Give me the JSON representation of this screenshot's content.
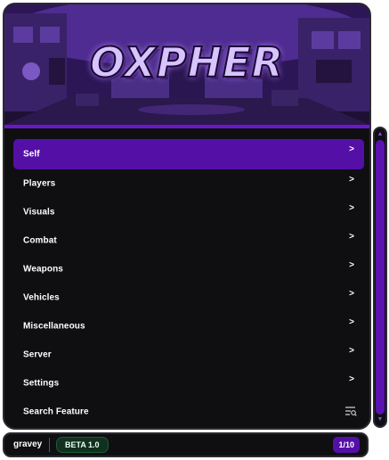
{
  "banner": {
    "logo_text": "OXPHER"
  },
  "menu": {
    "items": [
      {
        "label": "Self",
        "arrow": ">"
      },
      {
        "label": "Players",
        "arrow": ">"
      },
      {
        "label": "Visuals",
        "arrow": ">"
      },
      {
        "label": "Combat",
        "arrow": ">"
      },
      {
        "label": "Weapons",
        "arrow": ">"
      },
      {
        "label": "Vehicles",
        "arrow": ">"
      },
      {
        "label": "Miscellaneous",
        "arrow": ">"
      },
      {
        "label": "Server",
        "arrow": ">"
      },
      {
        "label": "Settings",
        "arrow": ">"
      },
      {
        "label": "Search Feature",
        "icon": "search-list-icon"
      }
    ],
    "selected_index": 0
  },
  "footer": {
    "username": "gravey",
    "version": "BETA 1.0",
    "page_counter": "1/10"
  },
  "colors": {
    "accent": "#5410a6",
    "panel_bg": "#0f0f12",
    "badge_bg": "#11301f"
  }
}
